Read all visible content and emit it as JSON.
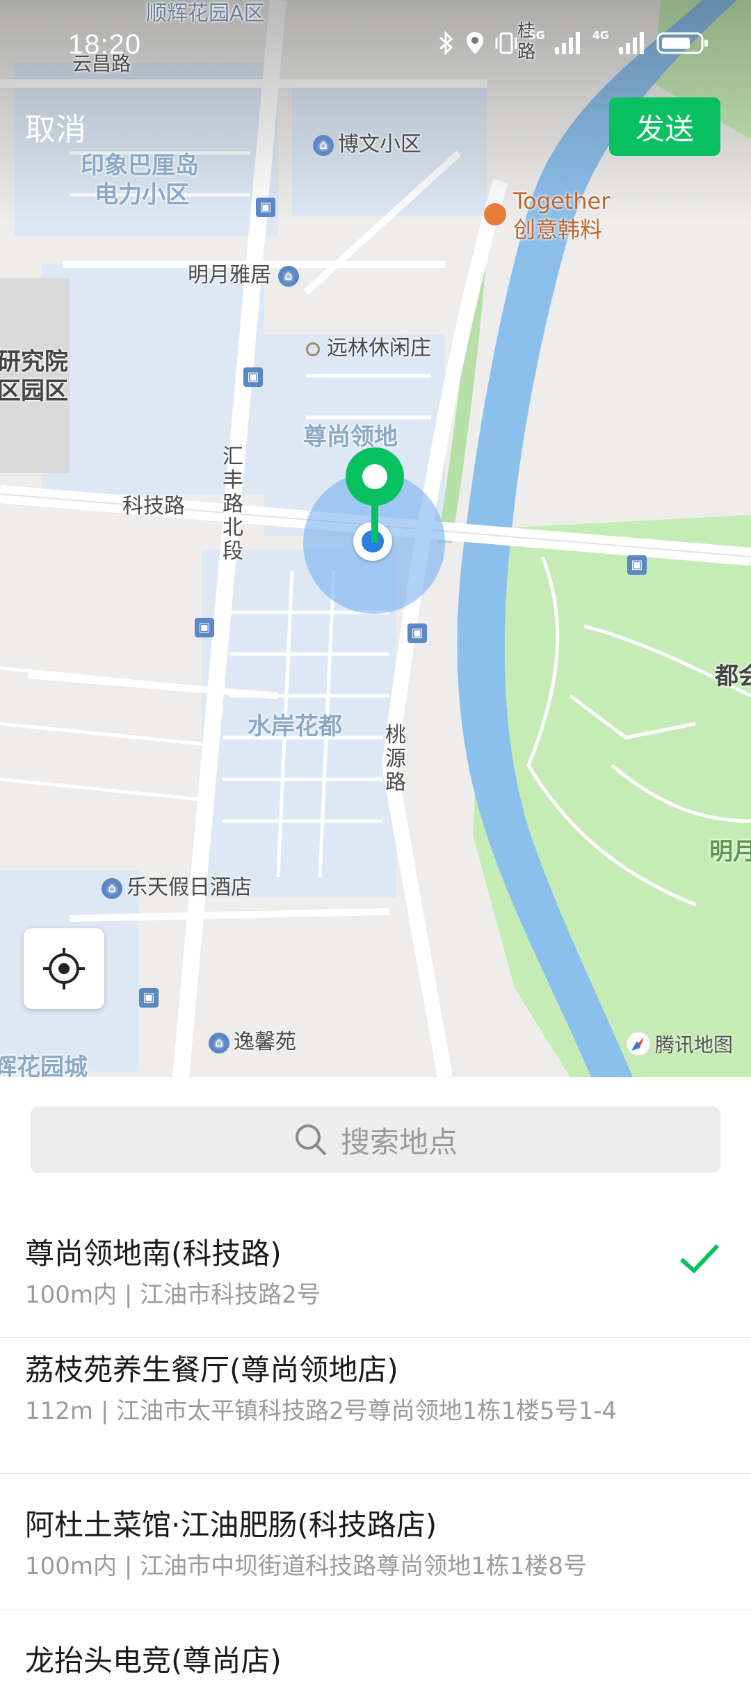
{
  "status_bar": {
    "time": "18:20",
    "network_1": "5G",
    "network_2": "4G"
  },
  "header": {
    "cancel_label": "取消",
    "send_label": "发送"
  },
  "map": {
    "labels": {
      "shunhui": "顺辉花园A区",
      "yunchang_road": "云昌路",
      "bowen": "博文小区",
      "yinxiang": "印象巴厘岛",
      "dianli": "电力小区",
      "together_1": "Together",
      "together_2": "创意韩料",
      "mingyue_yaju": "明月雅居",
      "yuanlin": "远林休闲庄",
      "yanjiuyuan_1": "研究院",
      "yanjiuyuan_2": "区园区",
      "zunshang": "尊尚领地",
      "keji_road": "科技路",
      "huifeng_road": "汇丰路北段",
      "taoyuan_road": "桃源路",
      "shuian": "水岸花都",
      "lotte": "乐天假日酒店",
      "yixin": "逸馨苑",
      "huahuayuancheng": "辉花园城",
      "duhui": "都会",
      "mingyue_park": "明月",
      "gui_road": "桂路"
    },
    "logo_text": "腾讯地图"
  },
  "search": {
    "placeholder": "搜索地点"
  },
  "results": [
    {
      "title": "尊尚领地南(科技路)",
      "subtitle": "100m内 | 江油市科技路2号",
      "selected": true
    },
    {
      "title": "荔枝苑养生餐厅(尊尚领地店)",
      "subtitle": "112m | 江油市太平镇科技路2号尊尚领地1栋1楼5号1-4",
      "selected": false
    },
    {
      "title": "阿杜土菜馆·江油肥肠(科技路店)",
      "subtitle": "100m内 | 江油市中坝街道科技路尊尚领地1栋1楼8号",
      "selected": false
    },
    {
      "title": "龙抬头电竞(尊尚店)",
      "subtitle": "",
      "selected": false
    }
  ],
  "colors": {
    "accent": "#07c160",
    "river": "#8cc0ec",
    "park": "#c6ecb6",
    "residential": "#dde8f4"
  }
}
